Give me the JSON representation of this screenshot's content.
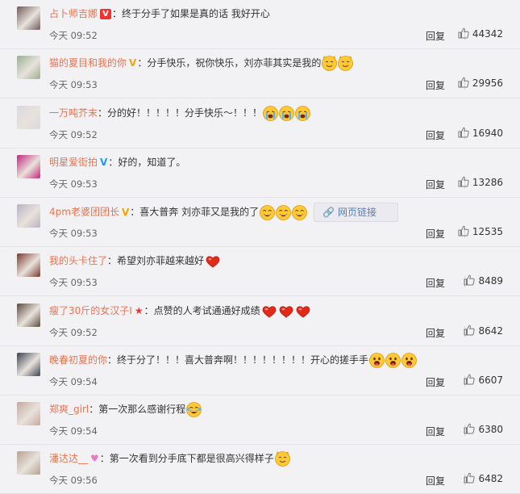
{
  "comments": [
    {
      "name": "占卜师吉娜",
      "badge": "V",
      "badge_style": "red",
      "text": "终于分手了如果是真的话 我好开心",
      "emojis": [],
      "time": "今天 09:52",
      "reply": "回复",
      "likes": "44342",
      "avatar_color": "#6f5a58"
    },
    {
      "name": "猫的夏目和我的你",
      "badge": "V",
      "badge_style": "gold",
      "text": "分手快乐，祝你快乐，刘亦菲其实是我的",
      "emojis": [
        "cat",
        "cat"
      ],
      "time": "今天 09:53",
      "reply": "回复",
      "likes": "29956",
      "avatar_color": "#9ab08f"
    },
    {
      "name": "一万吨芥末",
      "badge": "",
      "badge_style": "",
      "text": "分的好！！！！！分手快乐～！！！",
      "emojis": [
        "cry",
        "cry",
        "cry"
      ],
      "time": "今天 09:52",
      "reply": "回复",
      "likes": "16940",
      "avatar_color": "#d9d9de"
    },
    {
      "name": "明星爱街拍",
      "badge": "V",
      "badge_style": "blue",
      "text": "好的，知道了。",
      "emojis": [],
      "time": "今天 09:53",
      "reply": "回复",
      "likes": "13286",
      "avatar_color": "#c3267a"
    },
    {
      "name": "4pm老婆团团长",
      "badge": "V",
      "badge_style": "gold",
      "text": "喜大普奔 刘亦菲又是我的了",
      "emojis": [
        "laugh",
        "laugh",
        "laugh"
      ],
      "link": "网页链接",
      "time": "今天 09:53",
      "reply": "回复",
      "likes": "12535",
      "avatar_color": "#b9b2c4"
    },
    {
      "name": "我的头卡住了",
      "badge": "",
      "badge_style": "",
      "text": "希望刘亦菲越来越好",
      "emojis": [
        "heart"
      ],
      "time": "今天 09:53",
      "reply": "回复",
      "likes": "8489",
      "avatar_color": "#7a3b2e"
    },
    {
      "name": "瘦了30斤的女汉子I",
      "badge": "★",
      "badge_style": "star",
      "text": "点赞的人考试通通好成绩",
      "emojis": [
        "heart",
        "heart",
        "heart"
      ],
      "time": "今天 09:52",
      "reply": "回复",
      "likes": "8642",
      "avatar_color": "#5d4a3f"
    },
    {
      "name": "晚春初夏的你",
      "badge": "",
      "badge_style": "",
      "text": "终于分了！！！喜大普奔啊！！！！！！！！开心的搓手手",
      "emojis": [
        "grin",
        "grin",
        "grin"
      ],
      "time": "今天 09:54",
      "reply": "回复",
      "likes": "6607",
      "avatar_color": "#3c4250"
    },
    {
      "name": "郑爽_girl",
      "badge": "",
      "badge_style": "",
      "text": "第一次那么感谢行程",
      "emojis": [
        "lol"
      ],
      "time": "今天 09:54",
      "reply": "回复",
      "likes": "6380",
      "avatar_color": "#c5a9a0"
    },
    {
      "name": "潘达达__",
      "badge": "♥",
      "badge_style": "pink",
      "text": "第一次看到分手底下都是很高兴得样子",
      "emojis": [
        "cat"
      ],
      "time": "今天 09:56",
      "reply": "回复",
      "likes": "6482",
      "avatar_color": "#b7a290"
    }
  ],
  "colors": {
    "name": "#eb7350",
    "background": "#f2f2f5",
    "link": "#5a7fb0"
  },
  "icons": {
    "like": "thumb-up-icon",
    "link": "link-icon"
  }
}
